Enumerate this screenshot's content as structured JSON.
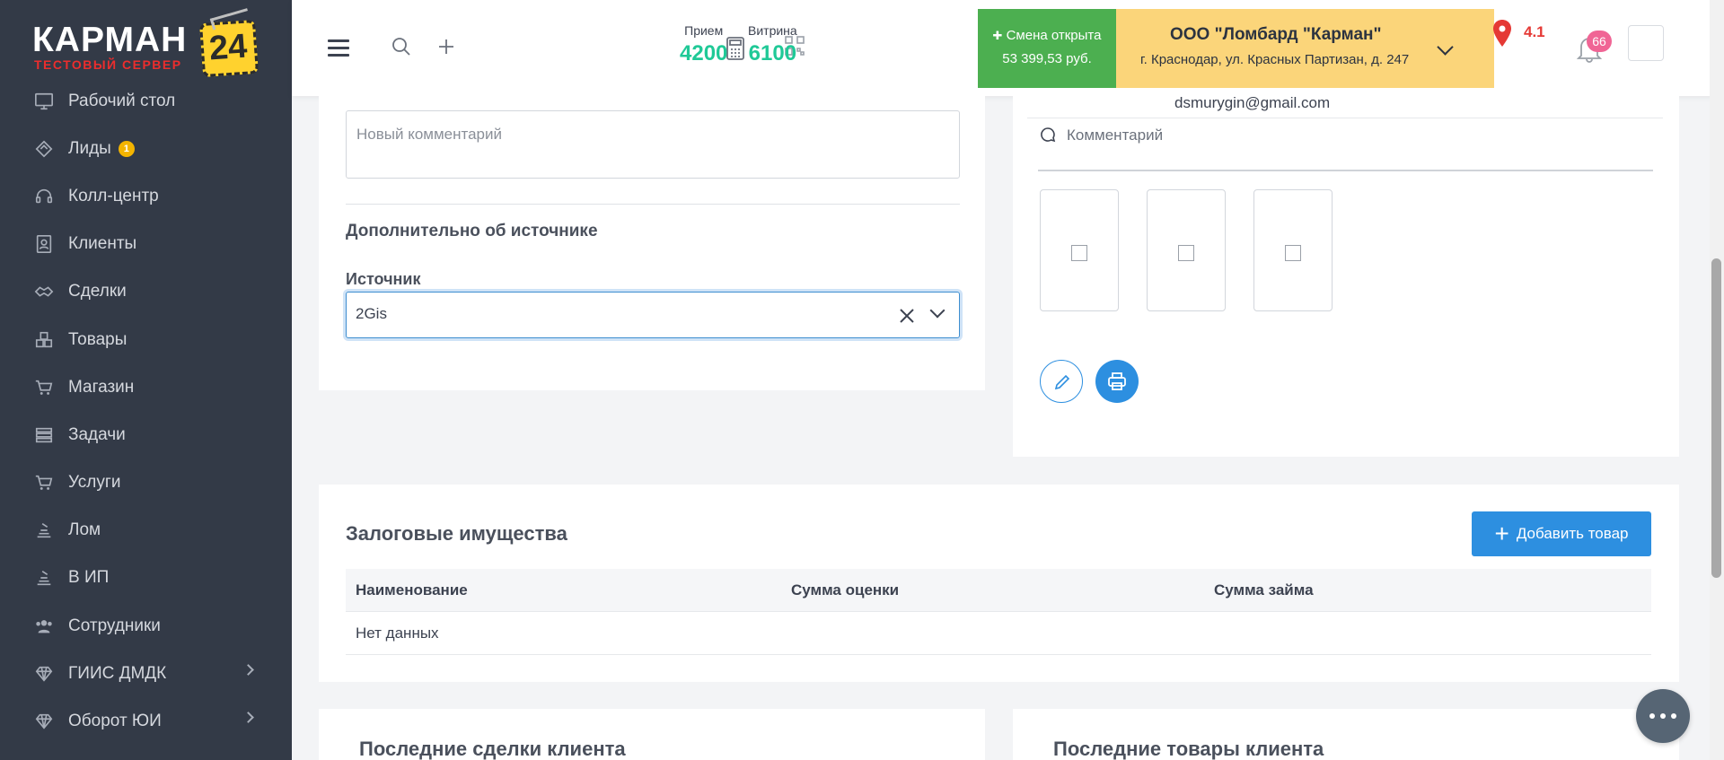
{
  "logo": {
    "brand": "КАРМАН",
    "sub": "ТЕСТОВЫЙ СЕРВЕР",
    "badge": "24"
  },
  "sidebar": {
    "items": [
      {
        "label": "Рабочий стол",
        "icon": "desktop-icon"
      },
      {
        "label": "Лиды",
        "icon": "leads-icon",
        "count": "1"
      },
      {
        "label": "Колл-центр",
        "icon": "headset-icon"
      },
      {
        "label": "Клиенты",
        "icon": "clients-icon"
      },
      {
        "label": "Сделки",
        "icon": "handshake-icon"
      },
      {
        "label": "Товары",
        "icon": "boxes-icon"
      },
      {
        "label": "Магазин",
        "icon": "cart-icon"
      },
      {
        "label": "Задачи",
        "icon": "tasks-icon"
      },
      {
        "label": "Услуги",
        "icon": "cart-icon"
      },
      {
        "label": "Лом",
        "icon": "scrap-icon"
      },
      {
        "label": "В ИП",
        "icon": "scrap-icon"
      },
      {
        "label": "Сотрудники",
        "icon": "users-icon"
      },
      {
        "label": "ГИИС ДМДК",
        "icon": "diamond-icon"
      },
      {
        "label": "Оборот ЮИ",
        "icon": "diamond-icon"
      }
    ]
  },
  "topbar": {
    "stats": [
      {
        "label": "Прием",
        "value": "4200"
      },
      {
        "label": "Витрина",
        "value": "6100"
      }
    ],
    "shift": {
      "title": "Смена открыта",
      "amount": "53 399,53 руб."
    },
    "company": {
      "name": "ООО \"Ломбард \"Карман\"",
      "address": "г. Краснодар, ул. Красных Партизан, д. 247"
    },
    "rating": "4.1",
    "notifications": "66"
  },
  "left_card": {
    "comment_placeholder": "Новый комментарий",
    "section_title": "Дополнительно об источнике",
    "source_label": "Источник",
    "source_value": "2Gis"
  },
  "right_card": {
    "email": "dsmurygin@gmail.com",
    "comment_label": "Комментарий"
  },
  "pledge": {
    "title": "Залоговые имущества",
    "add_button": "Добавить товар",
    "columns": [
      "Наименование",
      "Сумма оценки",
      "Сумма займа"
    ],
    "empty": "Нет данных"
  },
  "bottom": {
    "left_title": "Последние сделки клиента",
    "right_title": "Последние товары клиента"
  },
  "colors": {
    "sidebar": "#333a47",
    "accent": "#2d8fe0",
    "green": "#20c997",
    "shift": "#4caf50",
    "company": "#fbd57a"
  }
}
